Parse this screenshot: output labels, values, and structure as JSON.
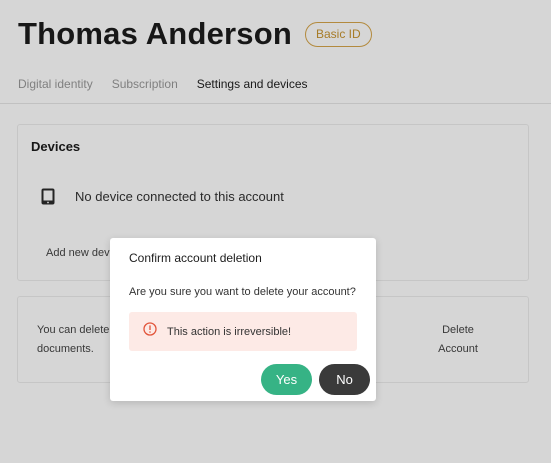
{
  "header": {
    "name": "Thomas Anderson",
    "badge": "Basic ID"
  },
  "tabs": [
    {
      "label": "Digital identity",
      "active": false
    },
    {
      "label": "Subscription",
      "active": false
    },
    {
      "label": "Settings and devices",
      "active": true
    }
  ],
  "devices_card": {
    "title": "Devices",
    "device_icon": "tablet-icon",
    "empty_text": "No device connected to this account",
    "add_device_label": "Add new device"
  },
  "delete_card": {
    "description": "You can delete documents.",
    "description_line1": "You can delete",
    "description_line2": "documents.",
    "delete_label_line1": "Delete",
    "delete_label_line2": "Account"
  },
  "modal": {
    "title": "Confirm account deletion",
    "question": "Are you sure you want to delete your account?",
    "warning_icon": "alert-circle-icon",
    "warning_text": "This action is irreversible!",
    "yes_label": "Yes",
    "no_label": "No"
  },
  "colors": {
    "badge": "#d6a54a",
    "yes_button": "#36b385",
    "no_button": "#3a3a3a",
    "warning_bg": "#fdeae6",
    "warning_icon": "#e2543a"
  }
}
